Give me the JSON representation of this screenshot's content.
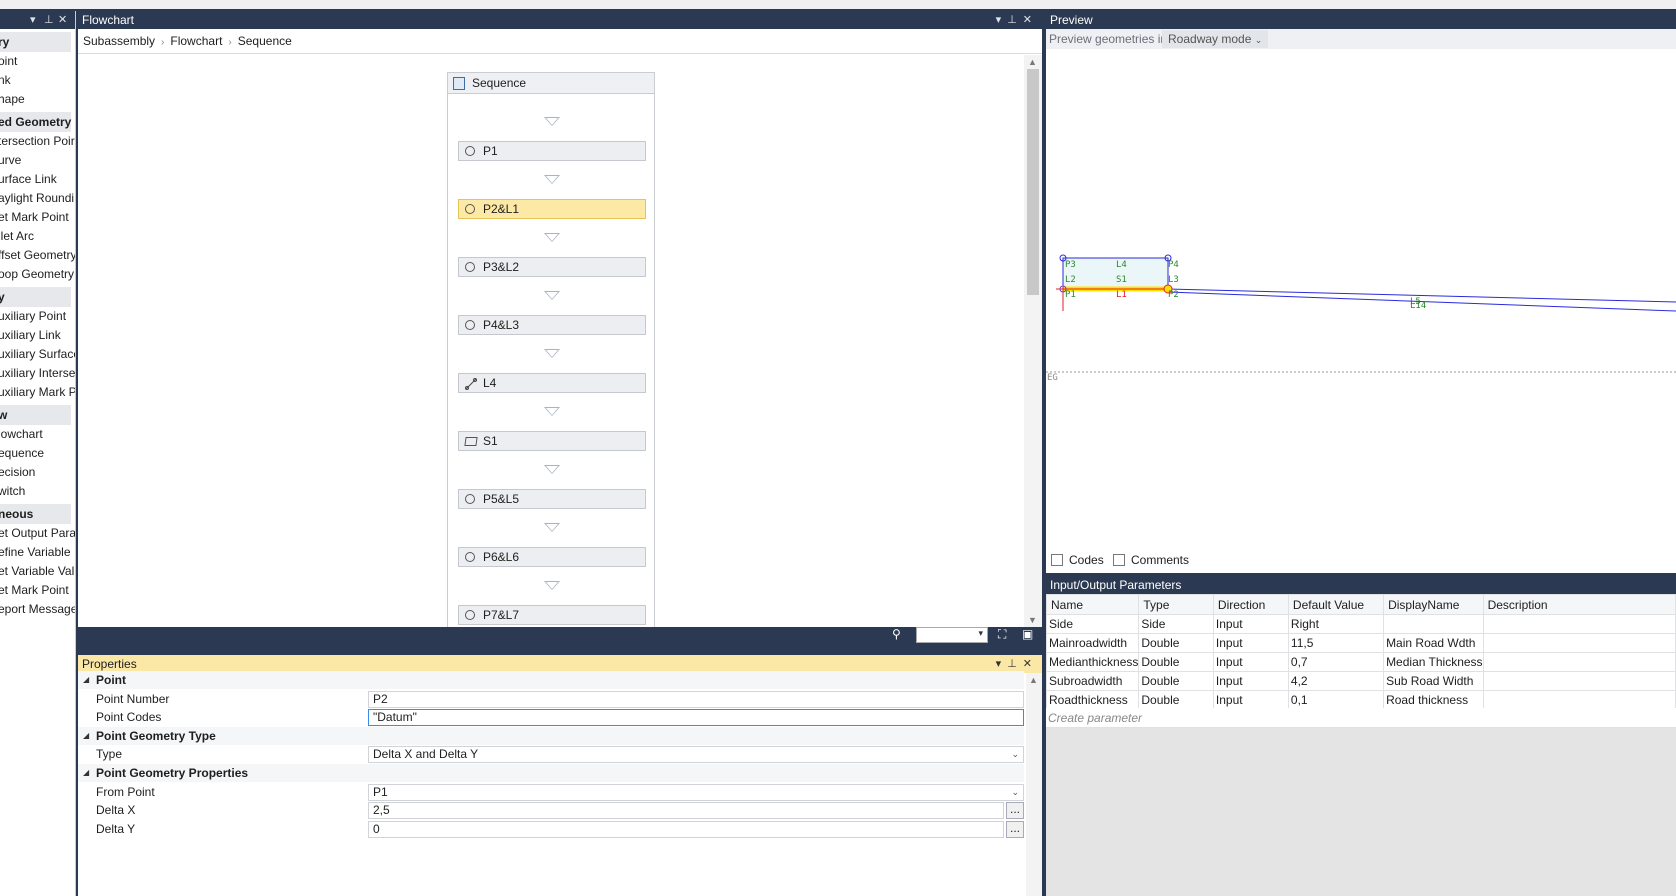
{
  "toolbox": {
    "categories": [
      {
        "label": "ry",
        "items": [
          "oint",
          "nk",
          "hape"
        ]
      },
      {
        "label": "ed Geometry",
        "items": [
          "tersection Poir",
          "urve",
          "urface Link",
          "aylight Roundi",
          "et Mark Point",
          "llet Arc",
          "ffset Geometry",
          "oop Geometry"
        ]
      },
      {
        "label": "y",
        "items": [
          "uxiliary Point",
          "uxiliary Link",
          "uxiliary Surface",
          "uxiliary Interse",
          "uxiliary Mark P"
        ]
      },
      {
        "label": "w",
        "items": [
          "lowchart",
          "equence",
          "ecision",
          "witch"
        ]
      },
      {
        "label": "neous",
        "items": [
          "et Output Para",
          "efine Variable",
          "et Variable Valu",
          "et Mark Point",
          "eport Message"
        ]
      }
    ]
  },
  "flowchart": {
    "title": "Flowchart",
    "breadcrumb": [
      "Subassembly",
      "Flowchart",
      "Sequence"
    ],
    "sequence_title": "Sequence",
    "nodes": [
      {
        "label": "P1",
        "icon": "point-icon",
        "selected": false
      },
      {
        "label": "P2&L1",
        "icon": "point-icon",
        "selected": true
      },
      {
        "label": "P3&L2",
        "icon": "point-icon",
        "selected": false
      },
      {
        "label": "P4&L3",
        "icon": "point-icon",
        "selected": false
      },
      {
        "label": "L4",
        "icon": "link-icon",
        "selected": false
      },
      {
        "label": "S1",
        "icon": "shape-icon",
        "selected": false
      },
      {
        "label": "P5&L5",
        "icon": "point-icon",
        "selected": false
      },
      {
        "label": "P6&L6",
        "icon": "point-icon",
        "selected": false
      },
      {
        "label": "P7&L7",
        "icon": "point-icon",
        "selected": false
      }
    ]
  },
  "properties": {
    "title": "Properties",
    "rows": [
      {
        "type": "cat",
        "label": "Point"
      },
      {
        "type": "prop",
        "label": "Point Number",
        "value": "P2"
      },
      {
        "type": "prop",
        "label": "Point Codes",
        "value": "\"Datum\"",
        "active": true
      },
      {
        "type": "cat",
        "label": "Point Geometry Type"
      },
      {
        "type": "prop",
        "label": "Type",
        "value": "Delta X and Delta Y",
        "dropdown": true
      },
      {
        "type": "cat",
        "label": "Point Geometry Properties"
      },
      {
        "type": "prop",
        "label": "From Point",
        "value": "P1",
        "dropdown": true
      },
      {
        "type": "prop",
        "label": "Delta X",
        "value": "2,5",
        "button": true
      },
      {
        "type": "prop",
        "label": "Delta Y",
        "value": "0",
        "button": true
      }
    ]
  },
  "preview": {
    "title": "Preview",
    "toolbar_label": "Preview geometries in",
    "mode": "Roadway mode",
    "labels": {
      "p3": "P3",
      "l4": "L4",
      "p4": "P4",
      "l2": "L2",
      "s1": "S1",
      "l3": "L3",
      "p1": "P1",
      "l1": "L1",
      "p2": "P2",
      "eg": "EG",
      "l5": "L5",
      "l14": "L14"
    },
    "codes_label": "Codes",
    "comments_label": "Comments"
  },
  "io": {
    "title": "Input/Output Parameters",
    "columns": [
      "Name",
      "Type",
      "Direction",
      "Default Value",
      "DisplayName",
      "Description"
    ],
    "rows": [
      [
        "Side",
        "Side",
        "Input",
        "Right",
        "",
        ""
      ],
      [
        "Mainroadwidth",
        "Double",
        "Input",
        "11,5",
        "Main Road Wdth",
        ""
      ],
      [
        "Medianthickness",
        "Double",
        "Input",
        "0,7",
        "Median Thickness",
        ""
      ],
      [
        "Subroadwidth",
        "Double",
        "Input",
        "4,2",
        "Sub Road Width",
        ""
      ],
      [
        "Roadthickness",
        "Double",
        "Input",
        "0,1",
        "Road thickness",
        ""
      ]
    ],
    "create_placeholder": "Create parameter"
  }
}
